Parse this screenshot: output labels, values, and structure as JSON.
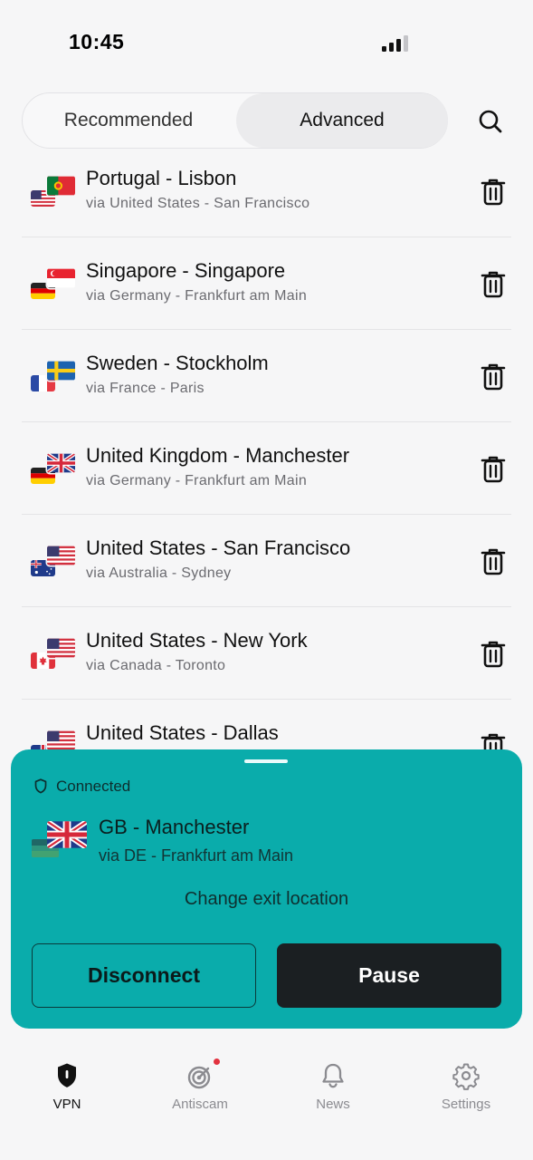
{
  "status_bar": {
    "time": "10:45"
  },
  "segments": {
    "recommended": "Recommended",
    "advanced": "Advanced",
    "active": "Advanced"
  },
  "locations": [
    {
      "title": "Portugal - Lisbon",
      "via": "via United States - San Francisco",
      "exit_flag": "pt",
      "entry_flag": "us"
    },
    {
      "title": "Singapore - Singapore",
      "via": "via Germany - Frankfurt am Main",
      "exit_flag": "sg",
      "entry_flag": "de"
    },
    {
      "title": "Sweden - Stockholm",
      "via": "via France - Paris",
      "exit_flag": "se",
      "entry_flag": "fr"
    },
    {
      "title": "United Kingdom - Manchester",
      "via": "via Germany - Frankfurt am Main",
      "exit_flag": "gb",
      "entry_flag": "de"
    },
    {
      "title": "United States - San Francisco",
      "via": "via Australia - Sydney",
      "exit_flag": "us",
      "entry_flag": "au"
    },
    {
      "title": "United States - New York",
      "via": "via Canada - Toronto",
      "exit_flag": "us",
      "entry_flag": "ca"
    },
    {
      "title": "United States - Dallas",
      "via": "",
      "exit_flag": "us",
      "entry_flag": "gb"
    }
  ],
  "connection": {
    "status": "Connected",
    "title": "GB - Manchester",
    "via": "via DE - Frankfurt am Main",
    "change_label": "Change exit location",
    "disconnect_label": "Disconnect",
    "pause_label": "Pause",
    "exit_flag": "gb",
    "entry_flag": "de"
  },
  "tabs": [
    {
      "label": "VPN",
      "icon": "shield-icon",
      "active": true
    },
    {
      "label": "Antiscam",
      "icon": "radar-icon",
      "active": false,
      "badge": true
    },
    {
      "label": "News",
      "icon": "bell-icon",
      "active": false
    },
    {
      "label": "Settings",
      "icon": "gear-icon",
      "active": false
    }
  ],
  "colors": {
    "accent": "#0aacab",
    "dark_button": "#1b1f22",
    "background": "#f6f6f7",
    "badge": "#e2323f"
  }
}
